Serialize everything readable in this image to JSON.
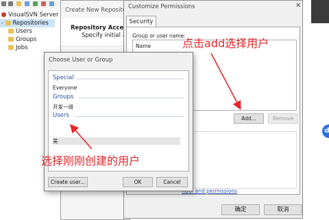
{
  "app": {
    "tree": [
      {
        "label": "VisualSVN Server (L",
        "selected": false
      },
      {
        "label": "Repositories",
        "selected": true
      },
      {
        "label": "Users",
        "selected": false
      },
      {
        "label": "Groups",
        "selected": false
      },
      {
        "label": "Jobs",
        "selected": false
      }
    ]
  },
  "wizard": {
    "title": "Create New Repositor",
    "heading": "Repository Access",
    "subtitle": "Specify initial acc"
  },
  "permissions": {
    "title": "Customize Permissions",
    "close_icon": "close-icon",
    "tab": "Security",
    "group_label": "Group or user name:",
    "column_name": "Name",
    "add_button": "Add...",
    "remove_button": "Remove",
    "advanced_link": "ntrol and permissions",
    "ok_button": "确定",
    "cancel_button": "取消"
  },
  "choose": {
    "title": "Choose User or Group",
    "groups": {
      "special": {
        "header": "Special",
        "items": [
          "Everyone"
        ]
      },
      "groups": {
        "header": "Groups",
        "items": [
          "开发一组"
        ]
      },
      "users": {
        "header": "Users",
        "items": [
          "吴"
        ]
      }
    },
    "create_button": "Create user...",
    "ok_button": "OK",
    "cancel_button": "Cancel"
  },
  "annotations": {
    "top": "点击add选择用户",
    "bottom": "选择刚刚创建的用户",
    "color": "#e5262b"
  },
  "colors": {
    "selection": "#cce4f7",
    "group_header": "#1e4e9c",
    "link": "#2a56b8"
  }
}
